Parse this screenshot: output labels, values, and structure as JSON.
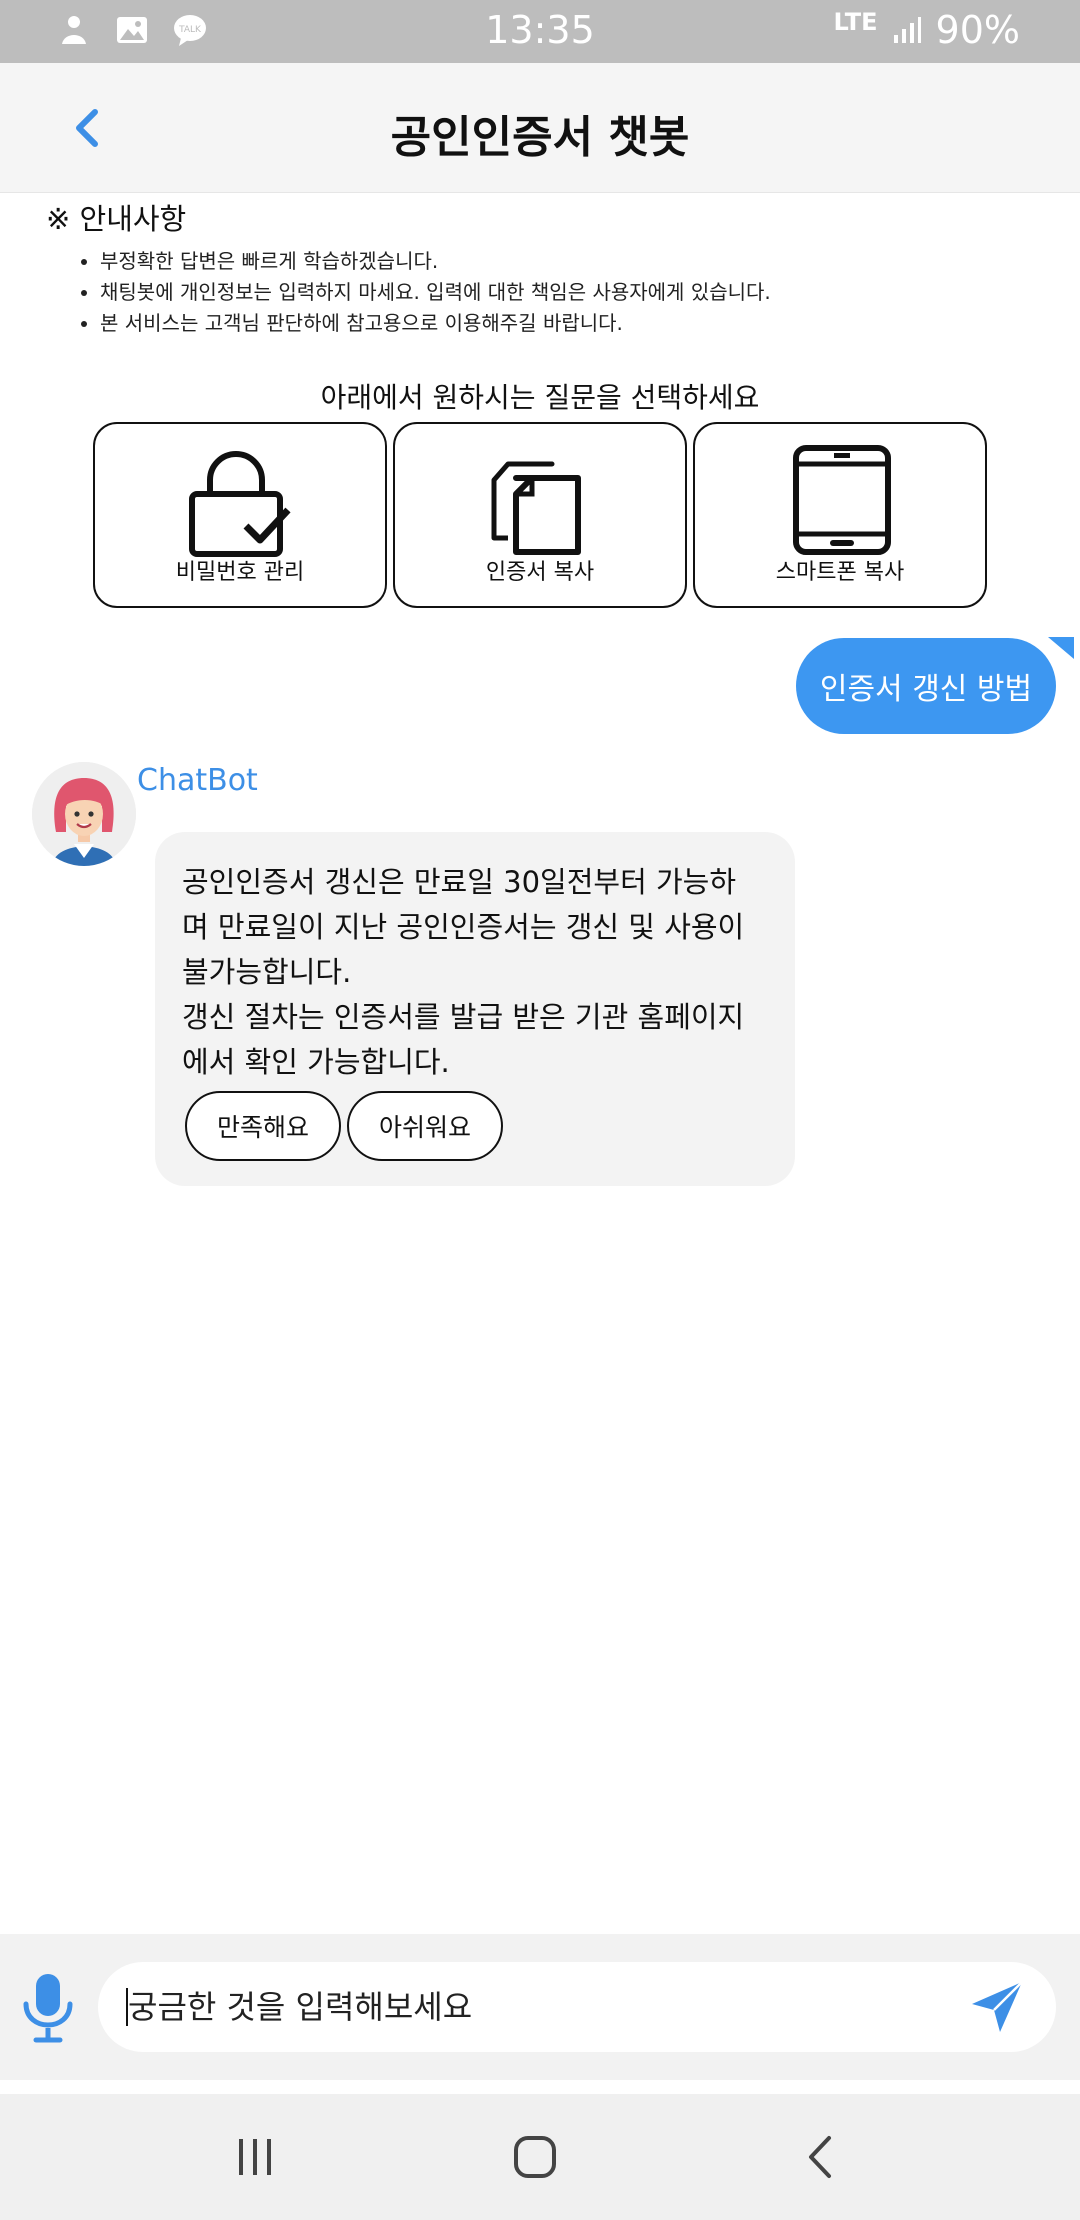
{
  "status_bar": {
    "time": "13:35",
    "network": "LTE",
    "battery": "90%",
    "left_icons": [
      "mascot-icon",
      "gallery-icon",
      "talk-icon"
    ],
    "talk_label": "TALK"
  },
  "header": {
    "title": "공인인증서 챗봇",
    "accent_color": "#3d8fe6"
  },
  "notice": {
    "title": "※ 안내사항",
    "items": [
      "부정확한 답변은 빠르게 학습하겠습니다.",
      "채팅봇에 개인정보는 입력하지 마세요. 입력에 대한 책임은 사용자에게 있습니다.",
      "본 서비스는 고객님 판단하에 참고용으로 이용해주길 바랍니다."
    ]
  },
  "menu": {
    "prompt": "아래에서 원하시는 질문을 선택하세요",
    "cards": [
      {
        "label": "비밀번호 관리",
        "icon": "lock-check-icon"
      },
      {
        "label": "인증서 복사",
        "icon": "copy-document-icon"
      },
      {
        "label": "스마트폰 복사",
        "icon": "tablet-icon"
      }
    ]
  },
  "messages": {
    "user": "인증서 갱신 방법",
    "bot_name": "ChatBot",
    "bot_lines": [
      "공인인증서 갱신은 만료일 30일전부터 가능하",
      "며 만료일이 지난 공인인증서는 갱신 및 사용이",
      "불가능합니다.",
      "갱신 절차는 인증서를 발급 받은 기관 홈페이지",
      "에서 확인 가능합니다."
    ],
    "feedback": [
      "만족해요",
      "아쉬워요"
    ]
  },
  "input": {
    "placeholder": "궁금한 것을 입력해보세요"
  },
  "colors": {
    "user_bubble": "#3d97f1",
    "bot_bubble": "#f3f3f3",
    "status_bar": "#bdbdbd"
  }
}
